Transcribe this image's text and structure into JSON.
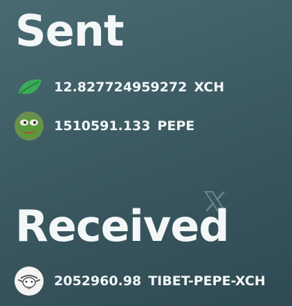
{
  "sent": {
    "title": "Sent",
    "items": [
      {
        "amount": "12.827724959272",
        "ticker": "XCH",
        "icon": "chia-leaf-icon"
      },
      {
        "amount": "1510591.133",
        "ticker": "PEPE",
        "icon": "pepe-frog-icon"
      }
    ]
  },
  "received": {
    "title": "Received",
    "items": [
      {
        "amount": "2052960.98",
        "ticker": "TIBET-PEPE-XCH",
        "icon": "tibet-swap-icon"
      }
    ]
  },
  "watermark": {
    "icon": "x-logo-icon"
  },
  "colors": {
    "background_top": "#4a6a72",
    "background_bottom": "#2f4a53",
    "text": "#f1f6f7",
    "chia_green": "#3aac59",
    "pepe_green": "#5a9a3a"
  }
}
